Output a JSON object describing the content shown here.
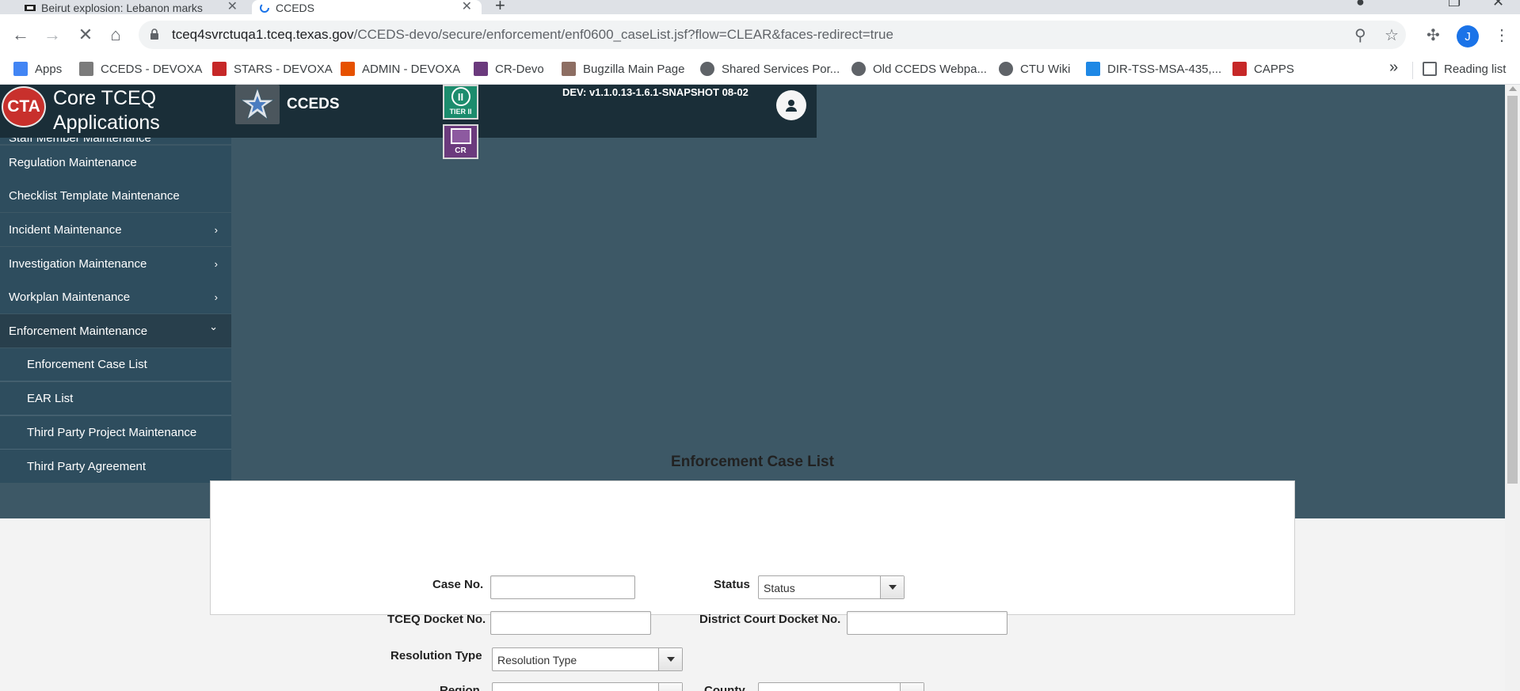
{
  "browser": {
    "tabs": [
      {
        "title": "Beirut explosion: Lebanon marks"
      },
      {
        "title": "CCEDS"
      }
    ],
    "url_host": "tceq4svrctuqa1.tceq.texas.gov",
    "url_path": "/CCEDS-devo/secure/enforcement/enf0600_caseList.jsf?flow=CLEAR&faces-redirect=true",
    "profile_initial": "J",
    "bookmarks": [
      {
        "label": "Apps",
        "icon": "apps-grid-icon",
        "color": "#4285f4"
      },
      {
        "label": "CCEDS - DEVOXA",
        "icon": "cceds-icon",
        "color": "#7b7b7b"
      },
      {
        "label": "STARS - DEVOXA",
        "icon": "stars-icon",
        "color": "#c62828"
      },
      {
        "label": "ADMIN - DEVOXA",
        "icon": "admin-icon",
        "color": "#e65100"
      },
      {
        "label": "CR-Devo",
        "icon": "cr-icon",
        "color": "#6b3a7d"
      },
      {
        "label": "Bugzilla Main Page",
        "icon": "bugzilla-icon",
        "color": "#8d6e63"
      },
      {
        "label": "Shared Services Por...",
        "icon": "globe-icon",
        "color": "#5f6368"
      },
      {
        "label": "Old CCEDS Webpa...",
        "icon": "old-cceds-icon",
        "color": "#5f6368"
      },
      {
        "label": "CTU Wiki",
        "icon": "globe-icon",
        "color": "#5f6368"
      },
      {
        "label": "DIR-TSS-MSA-435,...",
        "icon": "dir-icon",
        "color": "#1e88e5"
      },
      {
        "label": "CAPPS",
        "icon": "capps-icon",
        "color": "#c62828"
      }
    ],
    "reading_list": "Reading list"
  },
  "app": {
    "logo_abbr": "CTA",
    "logo_text": "Core TCEQ Applications",
    "app_name": "CCEDS",
    "tier_label": "TIER II",
    "cr_label": "CR",
    "version": "DEV: v1.1.0.13-1.6.1-SNAPSHOT 08-02"
  },
  "sidebar": {
    "partial_item": "Staff Member Maintenance",
    "items": [
      {
        "label": "Regulation Maintenance",
        "chevron": ""
      },
      {
        "label": "Checklist Template Maintenance",
        "chevron": ""
      },
      {
        "label": "Incident Maintenance",
        "chevron": "›"
      },
      {
        "label": "Investigation Maintenance",
        "chevron": "›"
      },
      {
        "label": "Workplan Maintenance",
        "chevron": "›"
      },
      {
        "label": "Enforcement Maintenance",
        "chevron": "⌄"
      }
    ],
    "subitems": [
      {
        "label": "Enforcement Case List"
      },
      {
        "label": "EAR List"
      },
      {
        "label": "Third Party Project Maintenance"
      },
      {
        "label": "Third Party Agreement"
      }
    ]
  },
  "form": {
    "title": "Enforcement Case List",
    "case_no_label": "Case No.",
    "case_no_value": "",
    "status_label": "Status",
    "status_value": "Status",
    "tceq_docket_label": "TCEQ Docket No.",
    "tceq_docket_value": "",
    "district_docket_label": "District Court Docket No.",
    "district_docket_value": "",
    "resolution_label": "Resolution Type",
    "resolution_value": "Resolution Type",
    "region_label": "Region",
    "county_label": "County"
  }
}
